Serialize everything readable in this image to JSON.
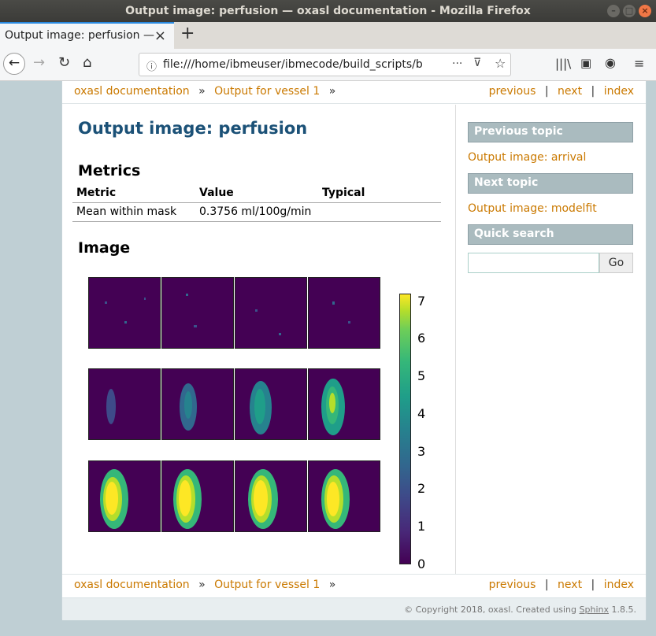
{
  "window": {
    "title": "Output image: perfusion — oxasl documentation - Mozilla Firefox"
  },
  "tab": {
    "label": "Output image: perfusion —",
    "new_tab": "+"
  },
  "url": "file:///home/ibmeuser/ibmecode/build_scripts/b",
  "relbar": {
    "home": "oxasl documentation",
    "parent": "Output for vessel 1",
    "arrow": "»",
    "previous": "previous",
    "next": "next",
    "index": "index",
    "sep": "|"
  },
  "page": {
    "title": "Output image: perfusion",
    "metrics_heading": "Metrics",
    "table_headers": [
      "Metric",
      "Value",
      "Typical"
    ],
    "table_row": [
      "Mean within mask",
      "0.3756 ml/100g/min",
      ""
    ],
    "image_heading": "Image"
  },
  "colorbar": {
    "ticks": [
      "7",
      "6",
      "5",
      "4",
      "3",
      "2",
      "1",
      "0"
    ],
    "min": 0,
    "max": 7.2
  },
  "sidebar": {
    "prev_heading": "Previous topic",
    "prev_link": "Output image: arrival",
    "next_heading": "Next topic",
    "next_link": "Output image: modelfit",
    "search_heading": "Quick search",
    "search_button": "Go"
  },
  "footer": {
    "text": "© Copyright 2018, oxasl. Created using",
    "link": "Sphinx",
    "version": "1.8.5."
  },
  "colors": {
    "link": "#ca7900",
    "title": "#1b5177",
    "sidebar_head": "#aabbbf",
    "viridis_low": "#440154",
    "viridis_high": "#fde725"
  }
}
